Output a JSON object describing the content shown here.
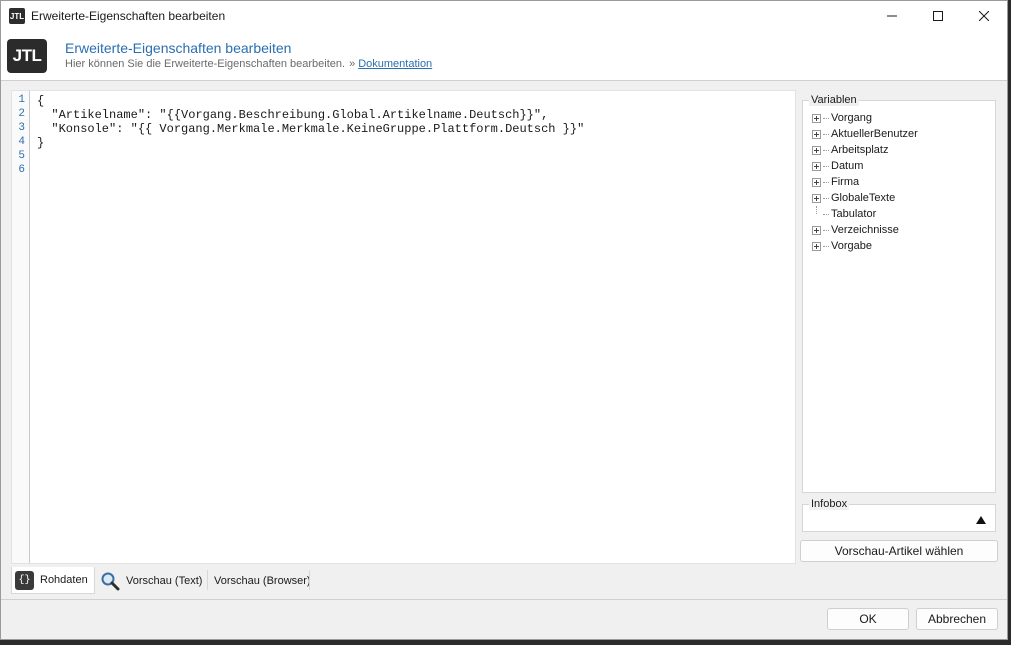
{
  "window": {
    "title": "Erweiterte-Eigenschaften bearbeiten",
    "app_icon_text": "JTL",
    "controls": [
      "minimize-icon",
      "maximize-icon",
      "close-icon"
    ]
  },
  "header": {
    "logo_text": "JTL",
    "title": "Erweiterte-Eigenschaften bearbeiten",
    "subtitle": "Hier können Sie die Erweiterte-Eigenschaften bearbeiten.",
    "separator": "»",
    "link": "Dokumentation"
  },
  "editor": {
    "line_numbers": [
      "1",
      "2",
      "3",
      "4",
      "5",
      "6"
    ],
    "lines": [
      "{",
      "  \"Artikelname\": \"{{Vorgang.Beschreibung.Global.Artikelname.Deutsch}}\",",
      "  \"Konsole\": \"{{ Vorgang.Merkmale.Merkmale.KeineGruppe.Plattform.Deutsch }}\"",
      "}",
      "",
      ""
    ]
  },
  "variables": {
    "legend": "Variablen",
    "items": [
      {
        "label": "Vorgang",
        "expandable": true
      },
      {
        "label": "AktuellerBenutzer",
        "expandable": true
      },
      {
        "label": "Arbeitsplatz",
        "expandable": true
      },
      {
        "label": "Datum",
        "expandable": true
      },
      {
        "label": "Firma",
        "expandable": true
      },
      {
        "label": "GlobaleTexte",
        "expandable": true
      },
      {
        "label": "Tabulator",
        "expandable": false
      },
      {
        "label": "Verzeichnisse",
        "expandable": true
      },
      {
        "label": "Vorgabe",
        "expandable": true
      }
    ]
  },
  "infobox": {
    "legend": "Infobox",
    "arrow_icon": "triangle-up-icon"
  },
  "buttons": {
    "preview": "Vorschau-Artikel wählen",
    "ok": "OK",
    "cancel": "Abbrechen"
  },
  "tabs": [
    {
      "label": "Rohdaten",
      "icon": "braces-icon",
      "active": true
    },
    {
      "label": "Vorschau (Text)",
      "icon": "magnifier-icon",
      "active": false
    },
    {
      "label": "Vorschau (Browser)",
      "icon": "",
      "active": false
    }
  ],
  "colors": {
    "accent": "#2a6fb0",
    "window_bg": "#f0f0f0"
  }
}
